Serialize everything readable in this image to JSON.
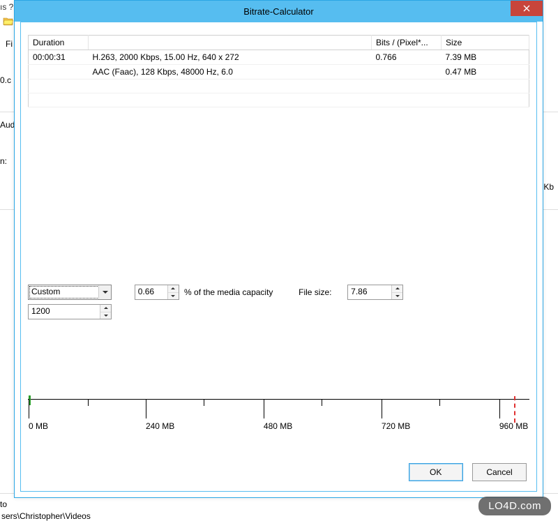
{
  "bg": {
    "menu_fragment": "ıs    ?",
    "fi": "Fi",
    "zeroc": "0.c",
    "aud": "Aud",
    "n": "n:",
    "kb": "Kb",
    "to": "to",
    "path": "sers\\Christopher\\Videos"
  },
  "dialog": {
    "title": "Bitrate-Calculator"
  },
  "table": {
    "headers": {
      "duration": "Duration",
      "desc": "",
      "bits": "Bits / (Pixel*...",
      "size": "Size"
    },
    "rows": [
      {
        "duration": "00:00:31",
        "desc": "H.263, 2000 Kbps, 15.00 Hz, 640 x 272",
        "bits": "0.766",
        "size": "7.39 MB"
      },
      {
        "duration": "",
        "desc": "AAC (Faac), 128 Kbps, 48000 Hz, 6.0",
        "bits": "",
        "size": "0.47 MB"
      }
    ]
  },
  "controls": {
    "preset": "Custom",
    "preset_value": "1200",
    "capacity_pct": "0.66",
    "capacity_label": "% of the media capacity",
    "filesize_label": "File size:",
    "filesize": "7.86"
  },
  "ruler": {
    "labels": [
      "0 MB",
      "240 MB",
      "480 MB",
      "720 MB",
      "960 MB"
    ]
  },
  "actions": {
    "ok": "OK",
    "cancel": "Cancel"
  },
  "watermark": "LO4D.com"
}
